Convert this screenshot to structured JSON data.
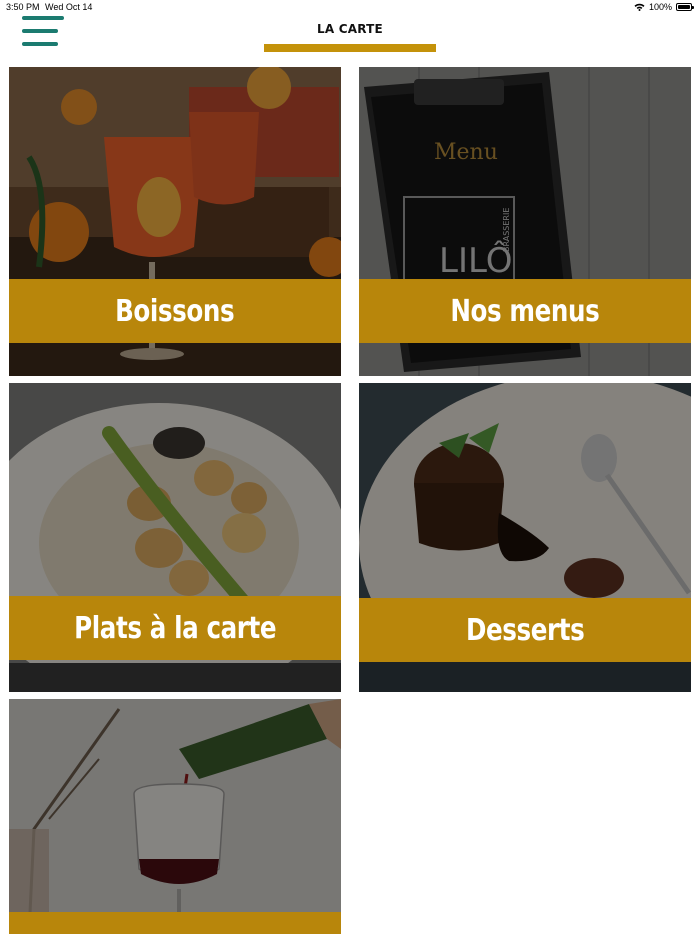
{
  "status_bar": {
    "time": "3:50 PM",
    "date": "Wed Oct 14",
    "battery": "100%",
    "wifi_icon": "wifi-icon",
    "battery_icon": "battery-icon"
  },
  "header": {
    "menu_icon": "hamburger-menu-icon",
    "title": "LA CARTE"
  },
  "colors": {
    "accent": "#b8860b",
    "menu_icon": "#1b7b70",
    "underline": "#c4920a"
  },
  "categories": [
    {
      "label": "Boissons",
      "image": "cocktail-drinks-photo"
    },
    {
      "label": "Nos menus",
      "image": "menu-clipboard-photo",
      "photo_text": {
        "menu": "Menu",
        "brand": "LILÔ",
        "brand_sub": "BRASSERIE"
      }
    },
    {
      "label": "Plats à la carte",
      "image": "scallops-risotto-photo"
    },
    {
      "label": "Desserts",
      "image": "chocolate-lava-cake-photo"
    },
    {
      "label": "",
      "image": "red-wine-pour-photo"
    }
  ]
}
